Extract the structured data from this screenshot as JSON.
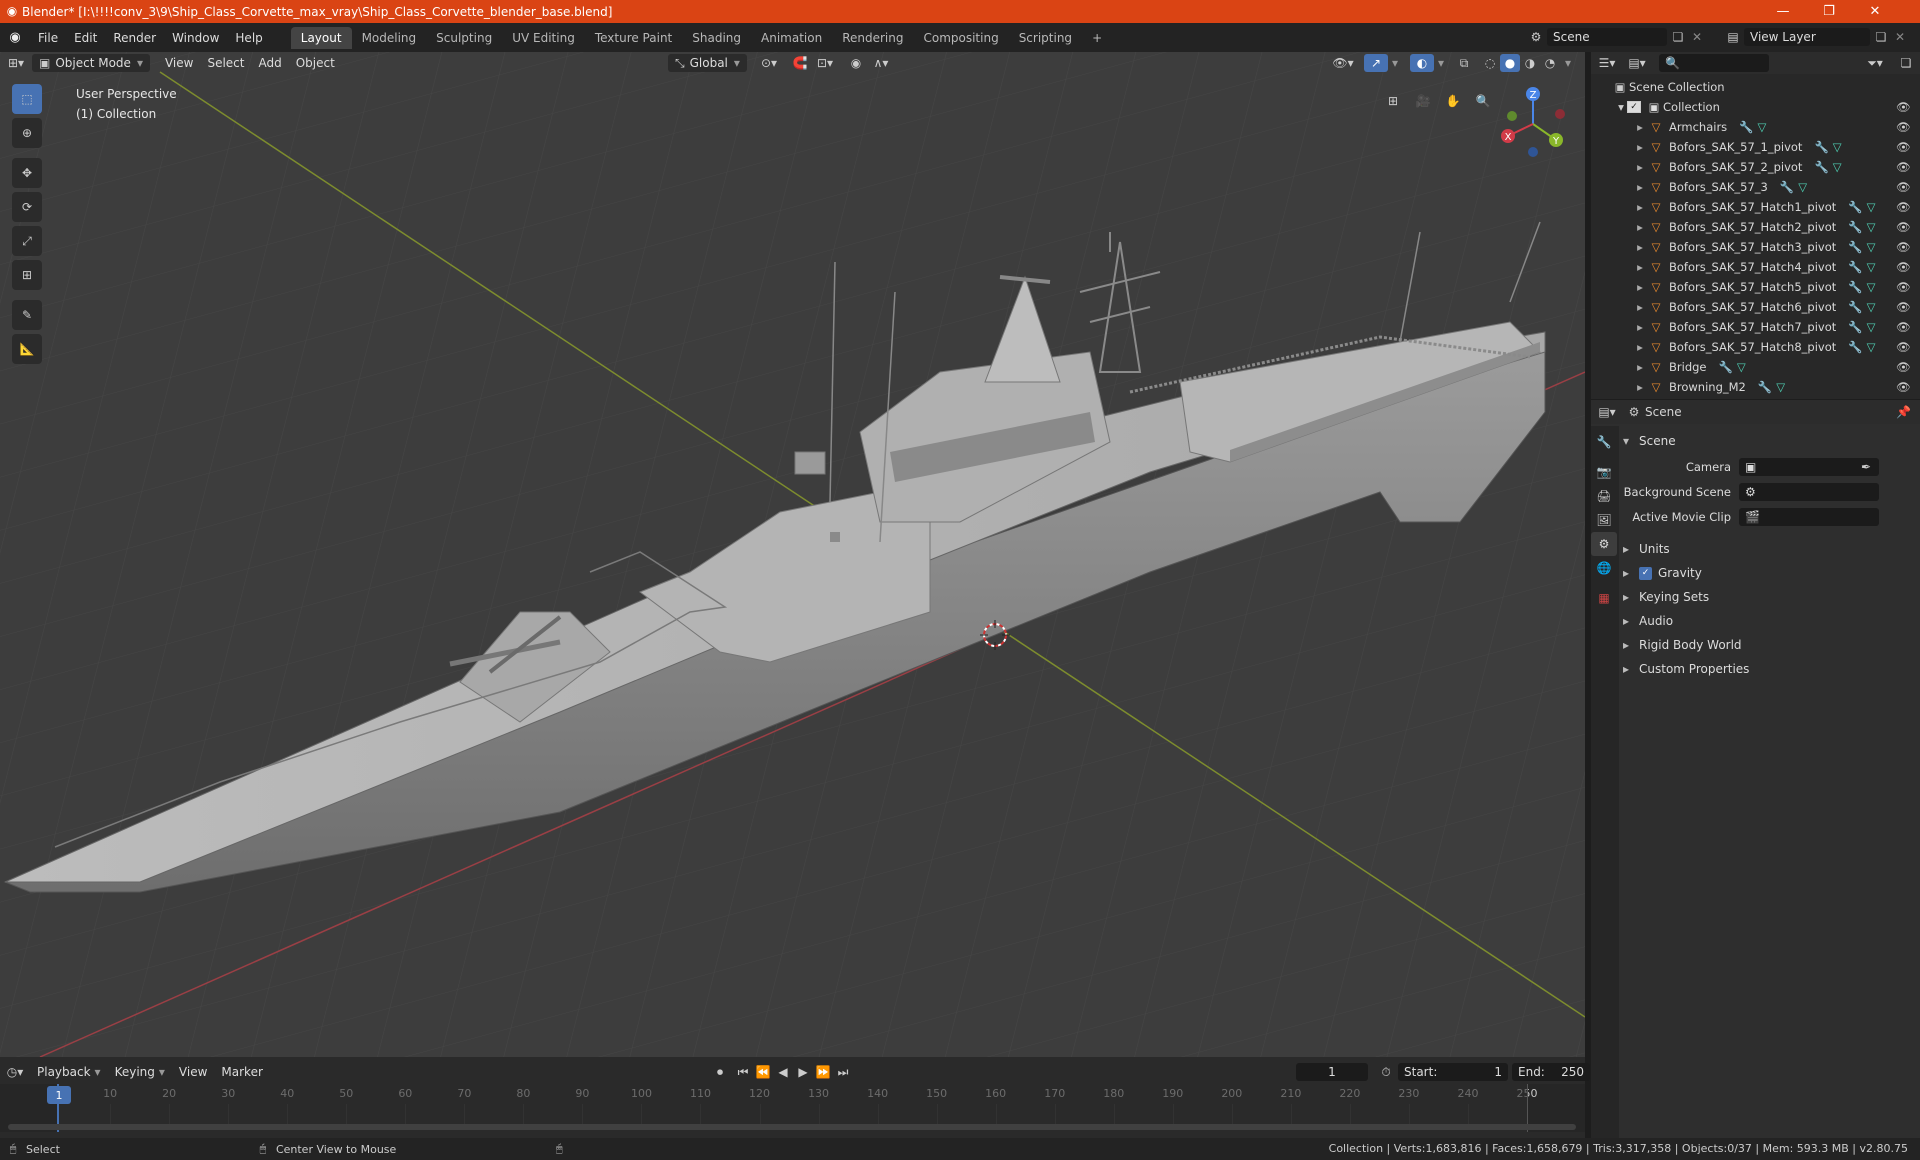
{
  "window": {
    "title": "Blender* [I:\\!!!!conv_3\\9\\Ship_Class_Corvette_max_vray\\Ship_Class_Corvette_blender_base.blend]"
  },
  "menus": [
    "File",
    "Edit",
    "Render",
    "Window",
    "Help"
  ],
  "workspaces": [
    "Layout",
    "Modeling",
    "Sculpting",
    "UV Editing",
    "Texture Paint",
    "Shading",
    "Animation",
    "Rendering",
    "Compositing",
    "Scripting"
  ],
  "scene_field": "Scene",
  "view_layer_field": "View Layer",
  "viewport": {
    "mode": "Object Mode",
    "menus": [
      "View",
      "Select",
      "Add",
      "Object"
    ],
    "transform_orientation": "Global",
    "overlay_line1": "User Perspective",
    "overlay_line2": "(1) Collection",
    "gizmo": {
      "z": "Z",
      "y": "Y",
      "x": "X"
    }
  },
  "outliner": {
    "root": "Scene Collection",
    "collection": "Collection",
    "items": [
      "Armchairs",
      "Bofors_SAK_57_1_pivot",
      "Bofors_SAK_57_2_pivot",
      "Bofors_SAK_57_3",
      "Bofors_SAK_57_Hatch1_pivot",
      "Bofors_SAK_57_Hatch2_pivot",
      "Bofors_SAK_57_Hatch3_pivot",
      "Bofors_SAK_57_Hatch4_pivot",
      "Bofors_SAK_57_Hatch5_pivot",
      "Bofors_SAK_57_Hatch6_pivot",
      "Bofors_SAK_57_Hatch7_pivot",
      "Bofors_SAK_57_Hatch8_pivot",
      "Bridge",
      "Browning_M2"
    ]
  },
  "properties": {
    "header": "Scene",
    "section": "Scene",
    "fields": [
      {
        "label": "Camera"
      },
      {
        "label": "Background Scene"
      },
      {
        "label": "Active Movie Clip"
      }
    ],
    "panels": [
      "Units",
      "Gravity",
      "Keying Sets",
      "Audio",
      "Rigid Body World",
      "Custom Properties"
    ],
    "gravity_checked": true
  },
  "timeline": {
    "menus": [
      "Playback",
      "Keying",
      "View",
      "Marker"
    ],
    "current_frame": "1",
    "start_label": "Start:",
    "start": "1",
    "end_label": "End:",
    "end": "250",
    "ticks": [
      "1",
      "10",
      "20",
      "30",
      "40",
      "50",
      "60",
      "70",
      "80",
      "90",
      "100",
      "110",
      "120",
      "130",
      "140",
      "150",
      "160",
      "170",
      "180",
      "190",
      "200",
      "210",
      "220",
      "230",
      "240",
      "250"
    ]
  },
  "statusbar": {
    "select": "Select",
    "center": "Center View to Mouse",
    "stats": "Collection | Verts:1,683,816 | Faces:1,658,679 | Tris:3,317,358 | Objects:0/37 | Mem: 593.3 MB | v2.80.75"
  },
  "colors": {
    "accent": "#4772b3",
    "titlebar": "#da4414",
    "viewport_bg": "#3d3d3d",
    "mesh_icon": "#e88a2e",
    "modifier_icon": "#6fa8dc",
    "data_icon": "#4fd1b5"
  }
}
